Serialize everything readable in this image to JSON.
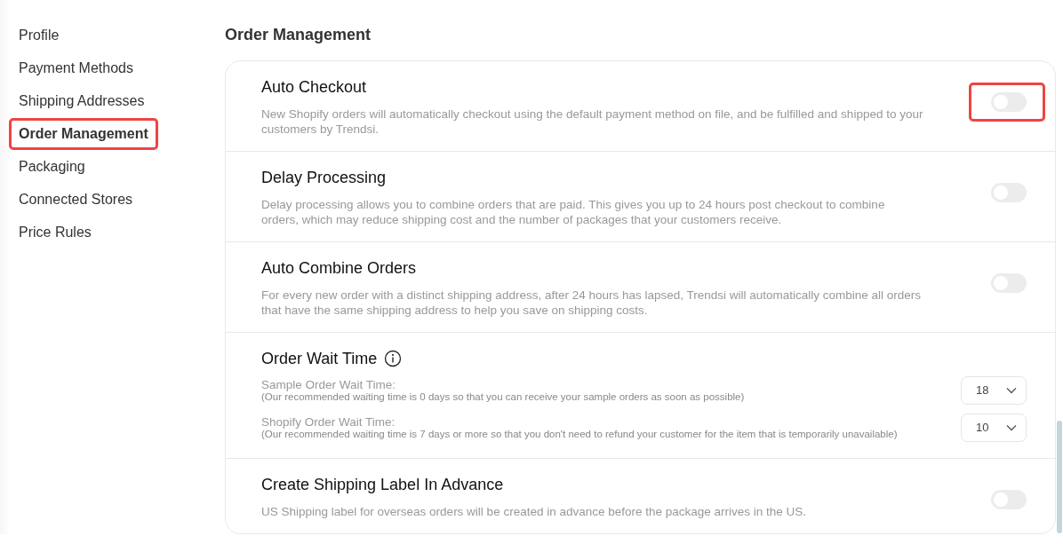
{
  "sidebar": {
    "items": [
      {
        "label": "Profile",
        "selected": false,
        "highlighted": false
      },
      {
        "label": "Payment Methods",
        "selected": false,
        "highlighted": false
      },
      {
        "label": "Shipping Addresses",
        "selected": false,
        "highlighted": false
      },
      {
        "label": "Order Management",
        "selected": true,
        "highlighted": true
      },
      {
        "label": "Packaging",
        "selected": false,
        "highlighted": false
      },
      {
        "label": "Connected Stores",
        "selected": false,
        "highlighted": false
      },
      {
        "label": "Price Rules",
        "selected": false,
        "highlighted": false
      }
    ]
  },
  "page_title": "Order Management",
  "settings": [
    {
      "kind": "toggle",
      "title": "Auto Checkout",
      "description": "New Shopify orders will automatically checkout using the default payment method on file, and be fulfilled and shipped to your customers by Trendsi.",
      "on": false,
      "highlighted": true
    },
    {
      "kind": "toggle",
      "title": "Delay Processing",
      "description": "Delay processing allows you to combine orders that are paid. This gives you up to 24 hours post checkout to combine orders, which may reduce shipping cost and the number of packages that your customers receive.",
      "on": false,
      "highlighted": false
    },
    {
      "kind": "toggle",
      "title": "Auto Combine Orders",
      "description": "For every new order with a distinct shipping address, after 24 hours has lapsed, Trendsi will automatically combine all orders that have the same shipping address to help you save on shipping costs.",
      "on": false,
      "highlighted": false
    },
    {
      "kind": "wait",
      "title": "Order Wait Time",
      "fields": [
        {
          "label": "Sample Order Wait Time:",
          "note": "(Our recommended waiting time is 0 days so that you can receive your sample orders as soon as possible)",
          "value": "18"
        },
        {
          "label": "Shopify Order Wait Time:",
          "note": "(Our recommended waiting time is 7 days or more so that you don't need to refund your customer for the item that is temporarily unavailable)",
          "value": "10"
        }
      ]
    },
    {
      "kind": "toggle",
      "title": "Create Shipping Label In Advance",
      "description": "US Shipping label for overseas orders will be created in advance before the package arrives in the US.",
      "on": false,
      "highlighted": false
    }
  ]
}
